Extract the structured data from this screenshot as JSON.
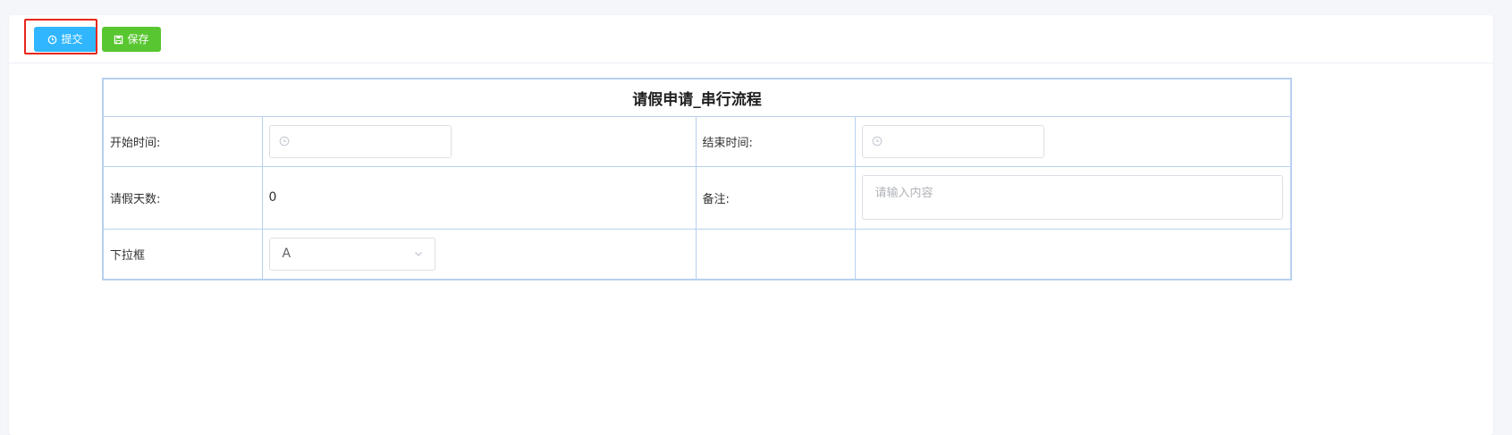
{
  "toolbar": {
    "submit_label": "提交",
    "save_label": "保存",
    "submit_icon": "clock-icon",
    "save_icon": "save-icon",
    "submit_color": "#2fb6ff",
    "save_color": "#58c630"
  },
  "form": {
    "title": "请假申请_串行流程",
    "start_time_label": "开始时间:",
    "start_time_value": "",
    "end_time_label": "结束时间:",
    "end_time_value": "",
    "days_label": "请假天数:",
    "days_value": "0",
    "remark_label": "备注:",
    "remark_placeholder": "请输入内容",
    "dropdown_label": "下拉框",
    "dropdown_value": "A"
  },
  "colors": {
    "table_border": "#b8d0ee",
    "highlight_border": "#e8261b"
  }
}
